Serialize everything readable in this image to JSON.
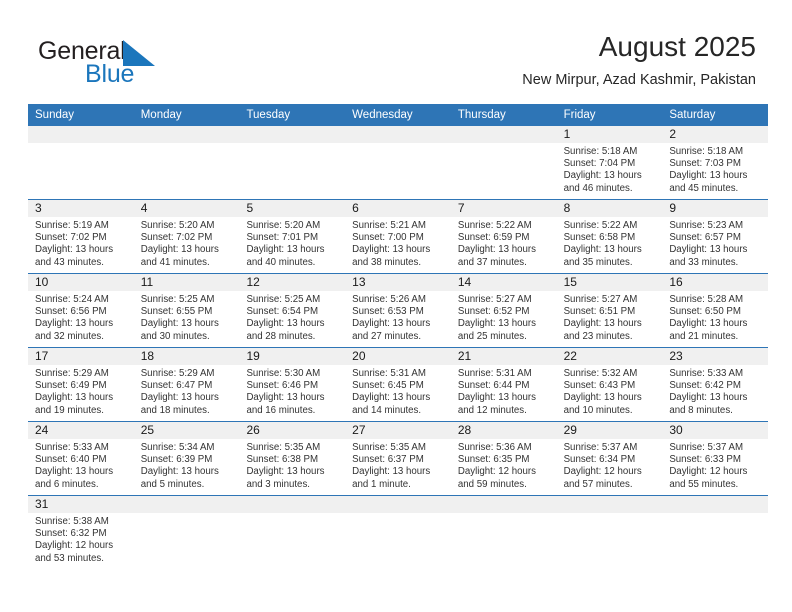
{
  "brand": {
    "name_top": "General",
    "name_bottom": "Blue",
    "flag_icon": "blue-triangle-flag-icon",
    "color_top": "#231f20",
    "color_bottom": "#1b76bc"
  },
  "header": {
    "title": "August 2025",
    "subtitle": "New Mirpur, Azad Kashmir, Pakistan"
  },
  "theme": {
    "header_bg": "#2e75b6",
    "header_text": "#ffffff",
    "daynum_bg": "#f0f0f0",
    "separator": "#2e75b6"
  },
  "weekdays": [
    "Sunday",
    "Monday",
    "Tuesday",
    "Wednesday",
    "Thursday",
    "Friday",
    "Saturday"
  ],
  "weeks": [
    [
      {
        "day": "",
        "sunrise": "",
        "sunset": "",
        "daylight_line1": "",
        "daylight_line2": ""
      },
      {
        "day": "",
        "sunrise": "",
        "sunset": "",
        "daylight_line1": "",
        "daylight_line2": ""
      },
      {
        "day": "",
        "sunrise": "",
        "sunset": "",
        "daylight_line1": "",
        "daylight_line2": ""
      },
      {
        "day": "",
        "sunrise": "",
        "sunset": "",
        "daylight_line1": "",
        "daylight_line2": ""
      },
      {
        "day": "",
        "sunrise": "",
        "sunset": "",
        "daylight_line1": "",
        "daylight_line2": ""
      },
      {
        "day": "1",
        "sunrise": "Sunrise: 5:18 AM",
        "sunset": "Sunset: 7:04 PM",
        "daylight_line1": "Daylight: 13 hours",
        "daylight_line2": "and 46 minutes."
      },
      {
        "day": "2",
        "sunrise": "Sunrise: 5:18 AM",
        "sunset": "Sunset: 7:03 PM",
        "daylight_line1": "Daylight: 13 hours",
        "daylight_line2": "and 45 minutes."
      }
    ],
    [
      {
        "day": "3",
        "sunrise": "Sunrise: 5:19 AM",
        "sunset": "Sunset: 7:02 PM",
        "daylight_line1": "Daylight: 13 hours",
        "daylight_line2": "and 43 minutes."
      },
      {
        "day": "4",
        "sunrise": "Sunrise: 5:20 AM",
        "sunset": "Sunset: 7:02 PM",
        "daylight_line1": "Daylight: 13 hours",
        "daylight_line2": "and 41 minutes."
      },
      {
        "day": "5",
        "sunrise": "Sunrise: 5:20 AM",
        "sunset": "Sunset: 7:01 PM",
        "daylight_line1": "Daylight: 13 hours",
        "daylight_line2": "and 40 minutes."
      },
      {
        "day": "6",
        "sunrise": "Sunrise: 5:21 AM",
        "sunset": "Sunset: 7:00 PM",
        "daylight_line1": "Daylight: 13 hours",
        "daylight_line2": "and 38 minutes."
      },
      {
        "day": "7",
        "sunrise": "Sunrise: 5:22 AM",
        "sunset": "Sunset: 6:59 PM",
        "daylight_line1": "Daylight: 13 hours",
        "daylight_line2": "and 37 minutes."
      },
      {
        "day": "8",
        "sunrise": "Sunrise: 5:22 AM",
        "sunset": "Sunset: 6:58 PM",
        "daylight_line1": "Daylight: 13 hours",
        "daylight_line2": "and 35 minutes."
      },
      {
        "day": "9",
        "sunrise": "Sunrise: 5:23 AM",
        "sunset": "Sunset: 6:57 PM",
        "daylight_line1": "Daylight: 13 hours",
        "daylight_line2": "and 33 minutes."
      }
    ],
    [
      {
        "day": "10",
        "sunrise": "Sunrise: 5:24 AM",
        "sunset": "Sunset: 6:56 PM",
        "daylight_line1": "Daylight: 13 hours",
        "daylight_line2": "and 32 minutes."
      },
      {
        "day": "11",
        "sunrise": "Sunrise: 5:25 AM",
        "sunset": "Sunset: 6:55 PM",
        "daylight_line1": "Daylight: 13 hours",
        "daylight_line2": "and 30 minutes."
      },
      {
        "day": "12",
        "sunrise": "Sunrise: 5:25 AM",
        "sunset": "Sunset: 6:54 PM",
        "daylight_line1": "Daylight: 13 hours",
        "daylight_line2": "and 28 minutes."
      },
      {
        "day": "13",
        "sunrise": "Sunrise: 5:26 AM",
        "sunset": "Sunset: 6:53 PM",
        "daylight_line1": "Daylight: 13 hours",
        "daylight_line2": "and 27 minutes."
      },
      {
        "day": "14",
        "sunrise": "Sunrise: 5:27 AM",
        "sunset": "Sunset: 6:52 PM",
        "daylight_line1": "Daylight: 13 hours",
        "daylight_line2": "and 25 minutes."
      },
      {
        "day": "15",
        "sunrise": "Sunrise: 5:27 AM",
        "sunset": "Sunset: 6:51 PM",
        "daylight_line1": "Daylight: 13 hours",
        "daylight_line2": "and 23 minutes."
      },
      {
        "day": "16",
        "sunrise": "Sunrise: 5:28 AM",
        "sunset": "Sunset: 6:50 PM",
        "daylight_line1": "Daylight: 13 hours",
        "daylight_line2": "and 21 minutes."
      }
    ],
    [
      {
        "day": "17",
        "sunrise": "Sunrise: 5:29 AM",
        "sunset": "Sunset: 6:49 PM",
        "daylight_line1": "Daylight: 13 hours",
        "daylight_line2": "and 19 minutes."
      },
      {
        "day": "18",
        "sunrise": "Sunrise: 5:29 AM",
        "sunset": "Sunset: 6:47 PM",
        "daylight_line1": "Daylight: 13 hours",
        "daylight_line2": "and 18 minutes."
      },
      {
        "day": "19",
        "sunrise": "Sunrise: 5:30 AM",
        "sunset": "Sunset: 6:46 PM",
        "daylight_line1": "Daylight: 13 hours",
        "daylight_line2": "and 16 minutes."
      },
      {
        "day": "20",
        "sunrise": "Sunrise: 5:31 AM",
        "sunset": "Sunset: 6:45 PM",
        "daylight_line1": "Daylight: 13 hours",
        "daylight_line2": "and 14 minutes."
      },
      {
        "day": "21",
        "sunrise": "Sunrise: 5:31 AM",
        "sunset": "Sunset: 6:44 PM",
        "daylight_line1": "Daylight: 13 hours",
        "daylight_line2": "and 12 minutes."
      },
      {
        "day": "22",
        "sunrise": "Sunrise: 5:32 AM",
        "sunset": "Sunset: 6:43 PM",
        "daylight_line1": "Daylight: 13 hours",
        "daylight_line2": "and 10 minutes."
      },
      {
        "day": "23",
        "sunrise": "Sunrise: 5:33 AM",
        "sunset": "Sunset: 6:42 PM",
        "daylight_line1": "Daylight: 13 hours",
        "daylight_line2": "and 8 minutes."
      }
    ],
    [
      {
        "day": "24",
        "sunrise": "Sunrise: 5:33 AM",
        "sunset": "Sunset: 6:40 PM",
        "daylight_line1": "Daylight: 13 hours",
        "daylight_line2": "and 6 minutes."
      },
      {
        "day": "25",
        "sunrise": "Sunrise: 5:34 AM",
        "sunset": "Sunset: 6:39 PM",
        "daylight_line1": "Daylight: 13 hours",
        "daylight_line2": "and 5 minutes."
      },
      {
        "day": "26",
        "sunrise": "Sunrise: 5:35 AM",
        "sunset": "Sunset: 6:38 PM",
        "daylight_line1": "Daylight: 13 hours",
        "daylight_line2": "and 3 minutes."
      },
      {
        "day": "27",
        "sunrise": "Sunrise: 5:35 AM",
        "sunset": "Sunset: 6:37 PM",
        "daylight_line1": "Daylight: 13 hours",
        "daylight_line2": "and 1 minute."
      },
      {
        "day": "28",
        "sunrise": "Sunrise: 5:36 AM",
        "sunset": "Sunset: 6:35 PM",
        "daylight_line1": "Daylight: 12 hours",
        "daylight_line2": "and 59 minutes."
      },
      {
        "day": "29",
        "sunrise": "Sunrise: 5:37 AM",
        "sunset": "Sunset: 6:34 PM",
        "daylight_line1": "Daylight: 12 hours",
        "daylight_line2": "and 57 minutes."
      },
      {
        "day": "30",
        "sunrise": "Sunrise: 5:37 AM",
        "sunset": "Sunset: 6:33 PM",
        "daylight_line1": "Daylight: 12 hours",
        "daylight_line2": "and 55 minutes."
      }
    ],
    [
      {
        "day": "31",
        "sunrise": "Sunrise: 5:38 AM",
        "sunset": "Sunset: 6:32 PM",
        "daylight_line1": "Daylight: 12 hours",
        "daylight_line2": "and 53 minutes."
      },
      {
        "day": "",
        "sunrise": "",
        "sunset": "",
        "daylight_line1": "",
        "daylight_line2": ""
      },
      {
        "day": "",
        "sunrise": "",
        "sunset": "",
        "daylight_line1": "",
        "daylight_line2": ""
      },
      {
        "day": "",
        "sunrise": "",
        "sunset": "",
        "daylight_line1": "",
        "daylight_line2": ""
      },
      {
        "day": "",
        "sunrise": "",
        "sunset": "",
        "daylight_line1": "",
        "daylight_line2": ""
      },
      {
        "day": "",
        "sunrise": "",
        "sunset": "",
        "daylight_line1": "",
        "daylight_line2": ""
      },
      {
        "day": "",
        "sunrise": "",
        "sunset": "",
        "daylight_line1": "",
        "daylight_line2": ""
      }
    ]
  ]
}
